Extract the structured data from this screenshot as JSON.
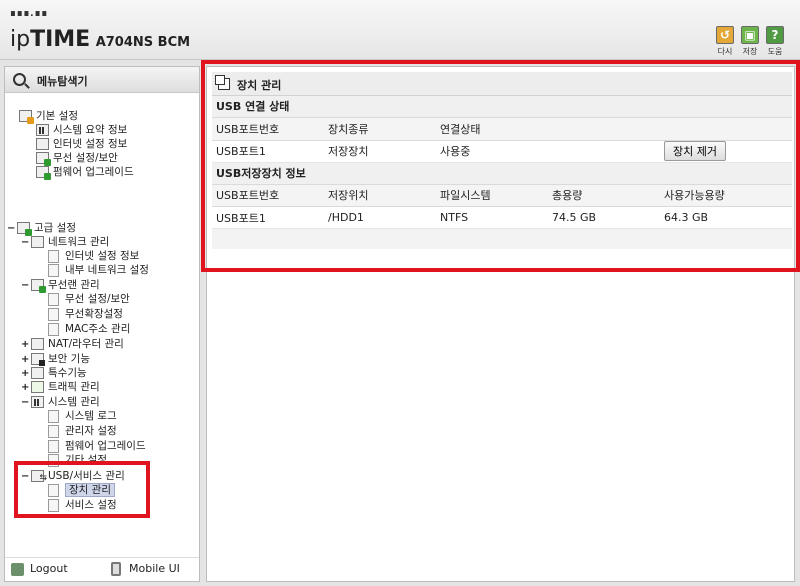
{
  "header": {
    "logo_dots": "∎∎∎.∎∎",
    "brand_ip": "ip",
    "brand_time": "TIME",
    "model": "A704NS BCM",
    "tools": [
      {
        "name": "refresh",
        "label": "다시",
        "icon": "refresh-icon",
        "color": "#e3a838",
        "glyph": "↺"
      },
      {
        "name": "save",
        "label": "저장",
        "icon": "save-icon",
        "color": "#6db54a",
        "glyph": "▣"
      },
      {
        "name": "help",
        "label": "도움",
        "icon": "help-icon",
        "color": "#4f9a43",
        "glyph": "?"
      }
    ]
  },
  "left": {
    "title": "메뉴탐색기",
    "basic": {
      "label": "기본 설정",
      "items": [
        "시스템 요약 정보",
        "인터넷 설정 정보",
        "무선 설정/보안",
        "펌웨어 업그레이드"
      ]
    },
    "advanced": {
      "label": "고급 설정",
      "network": {
        "label": "네트워크 관리",
        "items": [
          "인터넷 설정 정보",
          "내부 네트워크 설정"
        ]
      },
      "wireless": {
        "label": "무선랜 관리",
        "items": [
          "무선 설정/보안",
          "무선확장설정",
          "MAC주소 관리"
        ]
      },
      "nat": "NAT/라우터 관리",
      "security": "보안 기능",
      "special": "특수기능",
      "traffic": "트래픽 관리",
      "system": {
        "label": "시스템 관리",
        "items": [
          "시스템 로그",
          "관리자 설정",
          "펌웨어 업그레이드",
          "기타 설정"
        ]
      },
      "usb": {
        "label": "USB/서비스 관리",
        "items": [
          "장치 관리",
          "서비스 설정"
        ]
      }
    },
    "footer": {
      "logout": "Logout",
      "mobile": "Mobile UI"
    }
  },
  "main": {
    "title": "장치 관리",
    "usb_conn": {
      "heading": "USB 연결 상태",
      "columns": [
        "USB포트번호",
        "장치종류",
        "연결상태"
      ],
      "rows": [
        {
          "port": "USB포트1",
          "type": "저장장치",
          "status": "사용중",
          "action": "장치 제거"
        }
      ]
    },
    "usb_storage": {
      "heading": "USB저장장치 정보",
      "columns": [
        "USB포트번호",
        "저장위치",
        "파일시스템",
        "총용량",
        "사용가능용량"
      ],
      "rows": [
        {
          "port": "USB포트1",
          "location": "/HDD1",
          "fs": "NTFS",
          "total": "74.5 GB",
          "free": "64.3 GB"
        }
      ]
    }
  },
  "colors": {
    "highlight": "#e0141e",
    "selected_bg": "#cfd6ea"
  }
}
